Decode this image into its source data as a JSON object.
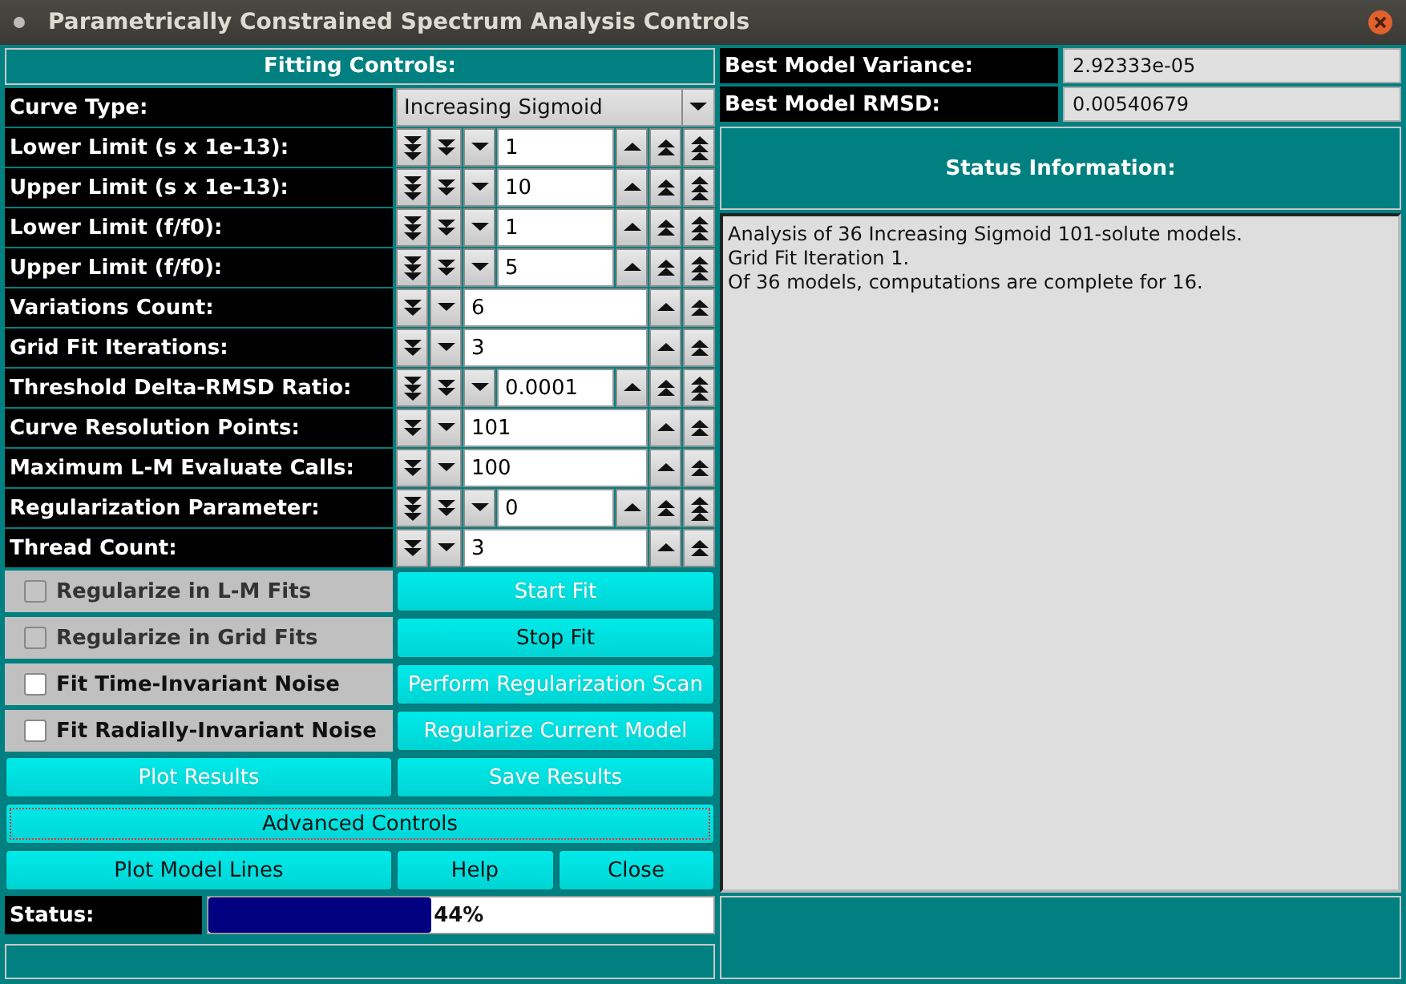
{
  "window": {
    "title": "Parametrically Constrained Spectrum Analysis Controls"
  },
  "fitting_controls": {
    "title": "Fitting Controls:"
  },
  "parameters": [
    {
      "kind": "dropdown",
      "label": "Curve Type:",
      "value": "Increasing Sigmoid"
    },
    {
      "kind": "counter3",
      "label": "Lower Limit (s x 1e-13):",
      "value": "1"
    },
    {
      "kind": "counter3",
      "label": "Upper Limit (s x 1e-13):",
      "value": "10"
    },
    {
      "kind": "counter3",
      "label": "Lower Limit (f/f0):",
      "value": "1"
    },
    {
      "kind": "counter3",
      "label": "Upper Limit (f/f0):",
      "value": "5"
    },
    {
      "kind": "counter2",
      "label": "Variations Count:",
      "value": "6"
    },
    {
      "kind": "counter2",
      "label": "Grid Fit Iterations:",
      "value": "3"
    },
    {
      "kind": "counter3",
      "label": "Threshold Delta-RMSD Ratio:",
      "value": "0.0001"
    },
    {
      "kind": "counter2",
      "label": "Curve Resolution Points:",
      "value": "101"
    },
    {
      "kind": "counter2",
      "label": "Maximum L-M Evaluate Calls:",
      "value": "100"
    },
    {
      "kind": "counter3",
      "label": "Regularization Parameter:",
      "value": "0"
    },
    {
      "kind": "counter2",
      "label": "Thread Count:",
      "value": "3"
    }
  ],
  "options": [
    {
      "label": "Regularize in L-M Fits",
      "checked": false,
      "disabled": true
    },
    {
      "label": "Regularize in Grid Fits",
      "checked": false,
      "disabled": true
    },
    {
      "label": "Fit Time-Invariant Noise",
      "checked": false,
      "disabled": false
    },
    {
      "label": "Fit Radially-Invariant Noise",
      "checked": false,
      "disabled": false
    }
  ],
  "side_buttons": [
    {
      "label": "Start Fit",
      "disabled": true
    },
    {
      "label": "Stop Fit",
      "disabled": false
    },
    {
      "label": "Perform Regularization Scan",
      "disabled": true
    },
    {
      "label": "Regularize Current Model",
      "disabled": true
    }
  ],
  "result_buttons": [
    {
      "label": "Plot Results",
      "disabled": true
    },
    {
      "label": "Save Results",
      "disabled": true
    }
  ],
  "advanced_button": {
    "label": "Advanced Controls",
    "disabled": false,
    "focused": true
  },
  "bottom_buttons": [
    {
      "label": "Plot Model Lines",
      "disabled": false
    },
    {
      "label": "Help",
      "disabled": false
    },
    {
      "label": "Close",
      "disabled": false
    }
  ],
  "status": {
    "label": "Status:",
    "level": 0.44,
    "reading": "44%"
  },
  "best_model": [
    {
      "label": "Best Model Variance:",
      "value": "2.92333e-05"
    },
    {
      "label": "Best Model RMSD:",
      "value": "0.00540679"
    }
  ],
  "status_information": {
    "title": "Status Information:",
    "lines": [
      "Analysis of 36 Increasing Sigmoid 101-solute models.",
      "Grid Fit Iteration 1.",
      "Of 36 models, computations are complete for 16."
    ]
  }
}
